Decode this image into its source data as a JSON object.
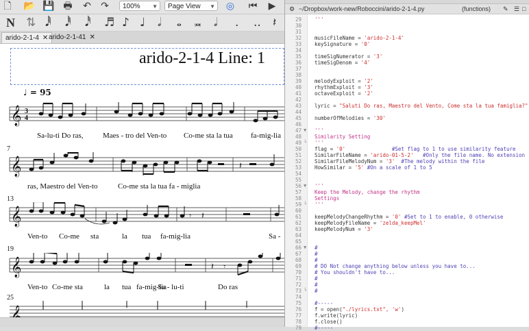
{
  "music_app": {
    "toolbar": {
      "zoom": "100%",
      "view": "Page View"
    },
    "tabs": [
      {
        "label": "arido-2-1-4",
        "active": true
      },
      {
        "label": "arido-2-1-41",
        "active": false
      }
    ],
    "score": {
      "title": "arido-2-1-4 Line: 1",
      "tempo": "♩ = 95",
      "systems": [
        {
          "measure": "",
          "lyrics": [
            "Sa-lu-ti Do ras,",
            "Maes - tro del Ven-to",
            "Co-me sta la tua",
            "fa-mig-lia"
          ]
        },
        {
          "measure": "7",
          "lyrics": [
            "ras, Maestro del Ven-to",
            "Co-me sta la tua fa - miglia"
          ]
        },
        {
          "measure": "13",
          "lyrics": [
            "Ven-to",
            "Co-me",
            "sta",
            "la",
            "tua",
            "fa-mig-lia",
            "Sa -"
          ]
        },
        {
          "measure": "19",
          "lyrics": [
            "Ven-to",
            "Co-me sta",
            "la",
            "tua",
            "fa-mig-lia",
            "Sa - lu-ti",
            "Do ras"
          ]
        },
        {
          "measure": "25",
          "lyrics": []
        }
      ]
    }
  },
  "editor": {
    "path": "~/Dropbox/work-new/Roboccini/arido-2-1-4.py",
    "function_menu": "(functions)",
    "lines": [
      {
        "n": "29",
        "fold": "",
        "text": "'''",
        "kind": "doc"
      },
      {
        "n": "30",
        "fold": "",
        "text": "",
        "kind": "plain"
      },
      {
        "n": "31",
        "fold": "",
        "text": "",
        "kind": "plain"
      },
      {
        "n": "32",
        "fold": "",
        "pre": "musicFileName = ",
        "str": "'arido-2-1-4'",
        "kind": "assign"
      },
      {
        "n": "33",
        "fold": "",
        "pre": "keySignature = ",
        "str": "'0'",
        "kind": "assign"
      },
      {
        "n": "34",
        "fold": "",
        "text": "",
        "kind": "plain"
      },
      {
        "n": "35",
        "fold": "",
        "pre": "timeSigNumerator = ",
        "str": "'3'",
        "kind": "assign"
      },
      {
        "n": "36",
        "fold": "",
        "pre": "timeSigDenom = ",
        "str": "'4'",
        "kind": "assign"
      },
      {
        "n": "37",
        "fold": "",
        "text": "",
        "kind": "plain"
      },
      {
        "n": "38",
        "fold": "",
        "text": "",
        "kind": "plain"
      },
      {
        "n": "39",
        "fold": "",
        "pre": "melodyExploit = ",
        "str": "'2'",
        "kind": "assign"
      },
      {
        "n": "40",
        "fold": "",
        "pre": "rhythmExploit = ",
        "str": "'3'",
        "kind": "assign"
      },
      {
        "n": "41",
        "fold": "",
        "pre": "octaveExploit = ",
        "str": "'2'",
        "kind": "assign"
      },
      {
        "n": "42",
        "fold": "",
        "text": "",
        "kind": "plain"
      },
      {
        "n": "43",
        "fold": "",
        "pre": "lyric = ",
        "str": "\"Saluti Do ras, Maestro del Vento, Come sta la tua famiglia?\"",
        "kind": "assign"
      },
      {
        "n": "44",
        "fold": "",
        "text": "",
        "kind": "plain"
      },
      {
        "n": "45",
        "fold": "",
        "pre": "numberOfMelodies = ",
        "str": "'30'",
        "kind": "assign"
      },
      {
        "n": "46",
        "fold": "",
        "text": "",
        "kind": "plain"
      },
      {
        "n": "47",
        "fold": "▼",
        "text": "'''",
        "kind": "doc"
      },
      {
        "n": "48",
        "fold": "",
        "text": "Similarity Setting",
        "kind": "doc"
      },
      {
        "n": "49",
        "fold": "└",
        "text": "'''",
        "kind": "doc"
      },
      {
        "n": "50",
        "fold": "",
        "pre": "flag = ",
        "str": "'0'",
        "com": "               #Set flag to 1 to use similarity feature",
        "kind": "assign"
      },
      {
        "n": "51",
        "fold": "",
        "pre": "SimilarFileName = ",
        "str": "'arido-01-5-2'",
        "com": "   #Only the file name. No extension",
        "kind": "assign"
      },
      {
        "n": "52",
        "fold": "",
        "pre": "SimilarFileMelodyNum = ",
        "str": "'3'",
        "com": "  #The melody within the file",
        "kind": "assign"
      },
      {
        "n": "53",
        "fold": "",
        "pre": "HowSimilar = ",
        "str": "'5'",
        "com": " #On a scale of 1 to 5",
        "kind": "assign"
      },
      {
        "n": "54",
        "fold": "",
        "text": "",
        "kind": "plain"
      },
      {
        "n": "55",
        "fold": "",
        "text": "",
        "kind": "plain"
      },
      {
        "n": "56",
        "fold": "▼",
        "text": "'''",
        "kind": "doc"
      },
      {
        "n": "57",
        "fold": "",
        "text": "Keep the Melody, change the rhythm",
        "kind": "doc"
      },
      {
        "n": "58",
        "fold": "",
        "text": "Settings",
        "kind": "doc"
      },
      {
        "n": "59",
        "fold": "└",
        "text": "'''",
        "kind": "doc"
      },
      {
        "n": "60",
        "fold": "",
        "text": "",
        "kind": "plain"
      },
      {
        "n": "61",
        "fold": "",
        "pre": "keepMelodyChangeRhythm = ",
        "str": "'0'",
        "com": " #Set to 1 to enable, 0 otherwise",
        "kind": "assign"
      },
      {
        "n": "62",
        "fold": "",
        "pre": "keepMelodyFileName = ",
        "str": "'zelda_keepMel'",
        "kind": "assign"
      },
      {
        "n": "63",
        "fold": "",
        "pre": "keepMelodyNum = ",
        "str": "'3'",
        "kind": "assign"
      },
      {
        "n": "64",
        "fold": "",
        "text": "",
        "kind": "plain"
      },
      {
        "n": "65",
        "fold": "",
        "text": "",
        "kind": "plain"
      },
      {
        "n": "66",
        "fold": "▼",
        "text": "#",
        "kind": "com"
      },
      {
        "n": "67",
        "fold": "",
        "text": "#",
        "kind": "com"
      },
      {
        "n": "68",
        "fold": "",
        "text": "#",
        "kind": "com"
      },
      {
        "n": "69",
        "fold": "",
        "text": "# DO Not change anything below unless you have to...",
        "kind": "com"
      },
      {
        "n": "70",
        "fold": "",
        "text": "# You shouldn't have to...",
        "kind": "com"
      },
      {
        "n": "71",
        "fold": "",
        "text": "#",
        "kind": "com"
      },
      {
        "n": "72",
        "fold": "",
        "text": "#",
        "kind": "com"
      },
      {
        "n": "73",
        "fold": "└",
        "text": "#",
        "kind": "com"
      },
      {
        "n": "74",
        "fold": "",
        "text": "",
        "kind": "plain"
      },
      {
        "n": "75",
        "fold": "",
        "text": "#-----",
        "kind": "com"
      },
      {
        "n": "76",
        "fold": "",
        "pre": "f = open(",
        "str": "\"./lyrics.txt\", 'w'",
        "post": ")",
        "kind": "assign"
      },
      {
        "n": "77",
        "fold": "",
        "text": "f.write(lyric)",
        "kind": "plain"
      },
      {
        "n": "78",
        "fold": "",
        "text": "f.close()",
        "kind": "plain"
      },
      {
        "n": "79",
        "fold": "",
        "text": "#-----",
        "kind": "com"
      }
    ]
  }
}
